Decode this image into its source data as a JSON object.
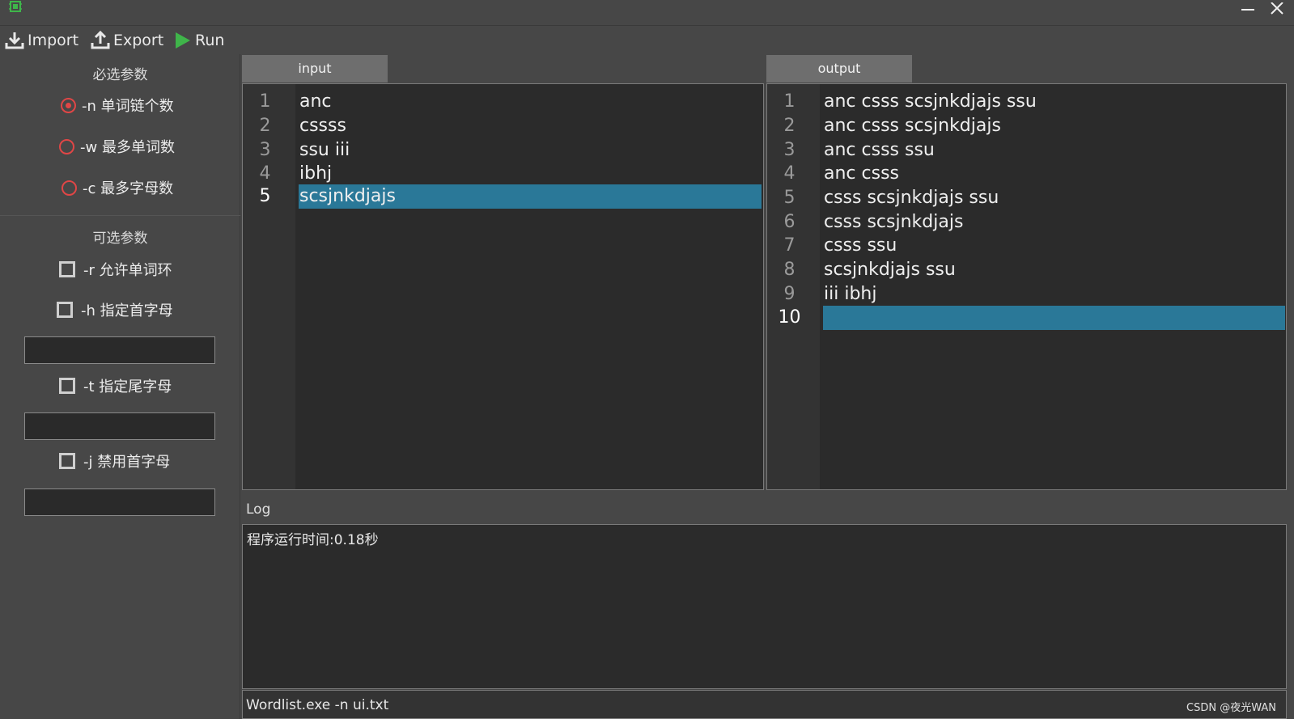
{
  "titlebar": {
    "app_icon": "chip-icon",
    "minimize_icon": "minimize-icon",
    "close_icon": "close-icon"
  },
  "toolbar": {
    "import_label": "Import",
    "export_label": "Export",
    "run_label": "Run",
    "run_color": "#3fb54a"
  },
  "sidebar": {
    "required_title": "必选参数",
    "required": [
      {
        "label": "-n 单词链个数",
        "checked": true
      },
      {
        "label": "-w 最多单词数",
        "checked": false
      },
      {
        "label": "-c 最多字母数",
        "checked": false
      }
    ],
    "optional_title": "可选参数",
    "optional": [
      {
        "label": "-r 允许单词环"
      },
      {
        "label": "-h 指定首字母",
        "value": ""
      },
      {
        "label": "-t 指定尾字母",
        "value": ""
      },
      {
        "label": "-j 禁用首字母",
        "value": ""
      }
    ],
    "radio_color": "#e04646"
  },
  "tabs": {
    "input": "input",
    "output": "output"
  },
  "input_editor": {
    "line_numbers": [
      "1",
      "2",
      "3",
      "4",
      "5"
    ],
    "lines": [
      "anc",
      "cssss",
      "ssu iii",
      "ibhj",
      "scsjnkdjajs"
    ],
    "current_line": 5
  },
  "output_editor": {
    "line_numbers": [
      "1",
      "2",
      "3",
      "4",
      "5",
      "6",
      "7",
      "8",
      "9",
      "10"
    ],
    "lines": [
      "anc csss scsjnkdjajs ssu",
      "anc csss scsjnkdjajs",
      "anc csss ssu",
      "anc csss",
      "csss scsjnkdjajs ssu",
      "csss scsjnkdjajs",
      "csss ssu",
      "scsjnkdjajs ssu",
      "iii ibhj",
      ""
    ],
    "current_line": 10
  },
  "highlight_color": "#2a7898",
  "log": {
    "label": "Log",
    "text": "程序运行时间:0.18秒"
  },
  "status": {
    "command": "Wordlist.exe -n ui.txt",
    "watermark": "CSDN @夜光WAN"
  }
}
